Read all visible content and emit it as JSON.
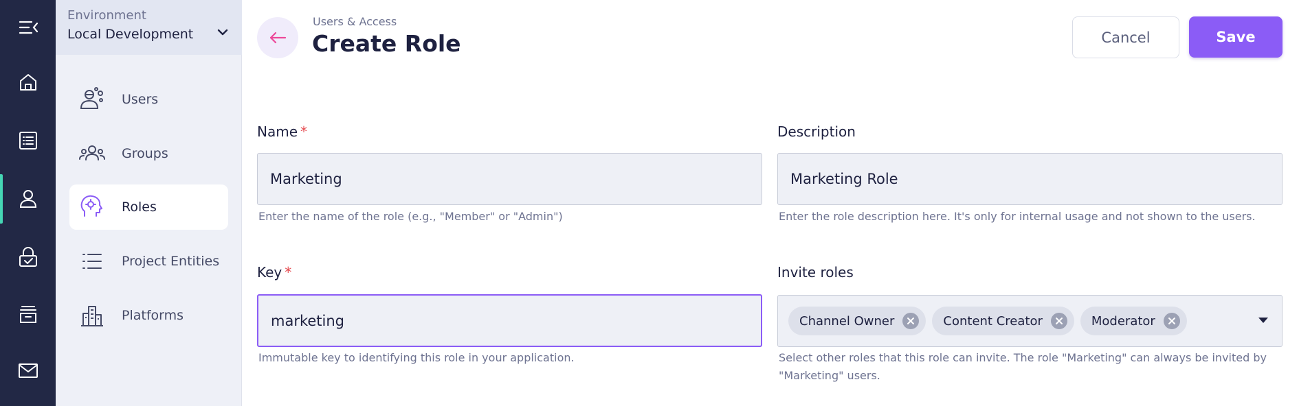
{
  "rail": {
    "icons": [
      "menu-collapse-icon",
      "home-icon",
      "list-icon",
      "user-icon",
      "lock-check-icon",
      "archive-icon",
      "mail-icon"
    ],
    "accent": "#45d6b4"
  },
  "environment": {
    "label": "Environment",
    "value": "Local Development"
  },
  "sidebar": {
    "items": [
      {
        "label": "Users",
        "icon": "user-settings-icon"
      },
      {
        "label": "Groups",
        "icon": "groups-icon"
      },
      {
        "label": "Roles",
        "icon": "role-head-icon",
        "active": true
      },
      {
        "label": "Project Entities",
        "icon": "numbered-list-icon"
      },
      {
        "label": "Platforms",
        "icon": "buildings-icon"
      }
    ]
  },
  "header": {
    "breadcrumb": "Users & Access",
    "title": "Create Role",
    "cancel_label": "Cancel",
    "save_label": "Save",
    "accent": "#8b5cf6"
  },
  "form": {
    "name": {
      "label": "Name",
      "required_mark": "*",
      "value": "Marketing",
      "help": "Enter the name of the role (e.g., \"Member\" or \"Admin\")"
    },
    "description": {
      "label": "Description",
      "value": "Marketing Role",
      "help": "Enter the role description here. It's only for internal usage and not shown to the users."
    },
    "key": {
      "label": "Key",
      "required_mark": "*",
      "value": "marketing",
      "help": "Immutable key to identifying this role in your application."
    },
    "invite_roles": {
      "label": "Invite roles",
      "chips": [
        "Channel Owner",
        "Content Creator",
        "Moderator"
      ],
      "help_line1": "Select other roles that this role can invite. The role \"Marketing\" can always be invited by",
      "help_line2": "\"Marketing\" users."
    }
  }
}
